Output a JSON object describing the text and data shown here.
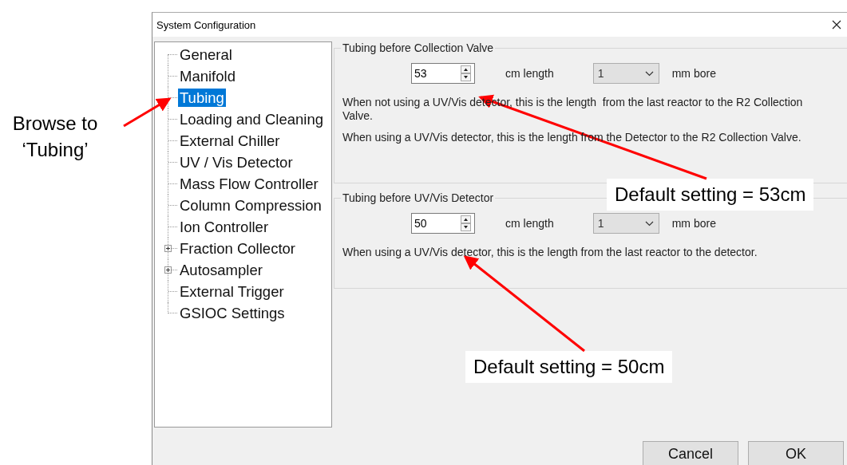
{
  "window": {
    "title": "System Configuration"
  },
  "tree": {
    "items": [
      {
        "label": "General",
        "kind": "leaf",
        "selected": false
      },
      {
        "label": "Manifold",
        "kind": "leaf",
        "selected": false
      },
      {
        "label": "Tubing",
        "kind": "leaf",
        "selected": true
      },
      {
        "label": "Loading and Cleaning",
        "kind": "leaf",
        "selected": false
      },
      {
        "label": "External Chiller",
        "kind": "leaf",
        "selected": false
      },
      {
        "label": "UV / Vis Detector",
        "kind": "leaf",
        "selected": false
      },
      {
        "label": "Mass Flow Controller",
        "kind": "leaf",
        "selected": false
      },
      {
        "label": "Column Compression",
        "kind": "leaf",
        "selected": false
      },
      {
        "label": "Ion Controller",
        "kind": "leaf",
        "selected": false
      },
      {
        "label": "Fraction Collector",
        "kind": "group",
        "selected": false
      },
      {
        "label": "Autosampler",
        "kind": "group",
        "selected": false
      },
      {
        "label": "External Trigger",
        "kind": "leaf",
        "selected": false
      },
      {
        "label": "GSIOC Settings",
        "kind": "leaf",
        "selected": false
      }
    ]
  },
  "sections": [
    {
      "title": "Tubing before Collection Valve",
      "length": "53",
      "length_unit": "cm length",
      "bore": "1",
      "bore_unit": "mm bore",
      "notes": [
        "When not using a UV/Vis detector, this is the length  from the last reactor to the R2 Collection Valve.",
        "When using a UV/Vis detector, this is the length from the Detector to the R2 Collection Valve."
      ]
    },
    {
      "title": "Tubing before UV/Vis Detector",
      "length": "50",
      "length_unit": "cm length",
      "bore": "1",
      "bore_unit": "mm bore",
      "notes": [
        "When using a UV/Vis detector, this is the length from the last reactor to the detector."
      ]
    }
  ],
  "buttons": [
    "Cancel",
    "OK"
  ],
  "annotations": [
    {
      "text": "Browse to ‘Tubing’",
      "kind": "plain"
    },
    {
      "text": "Default setting = 53cm",
      "kind": "boxed"
    },
    {
      "text": "Default setting = 50cm",
      "kind": "boxed"
    }
  ]
}
